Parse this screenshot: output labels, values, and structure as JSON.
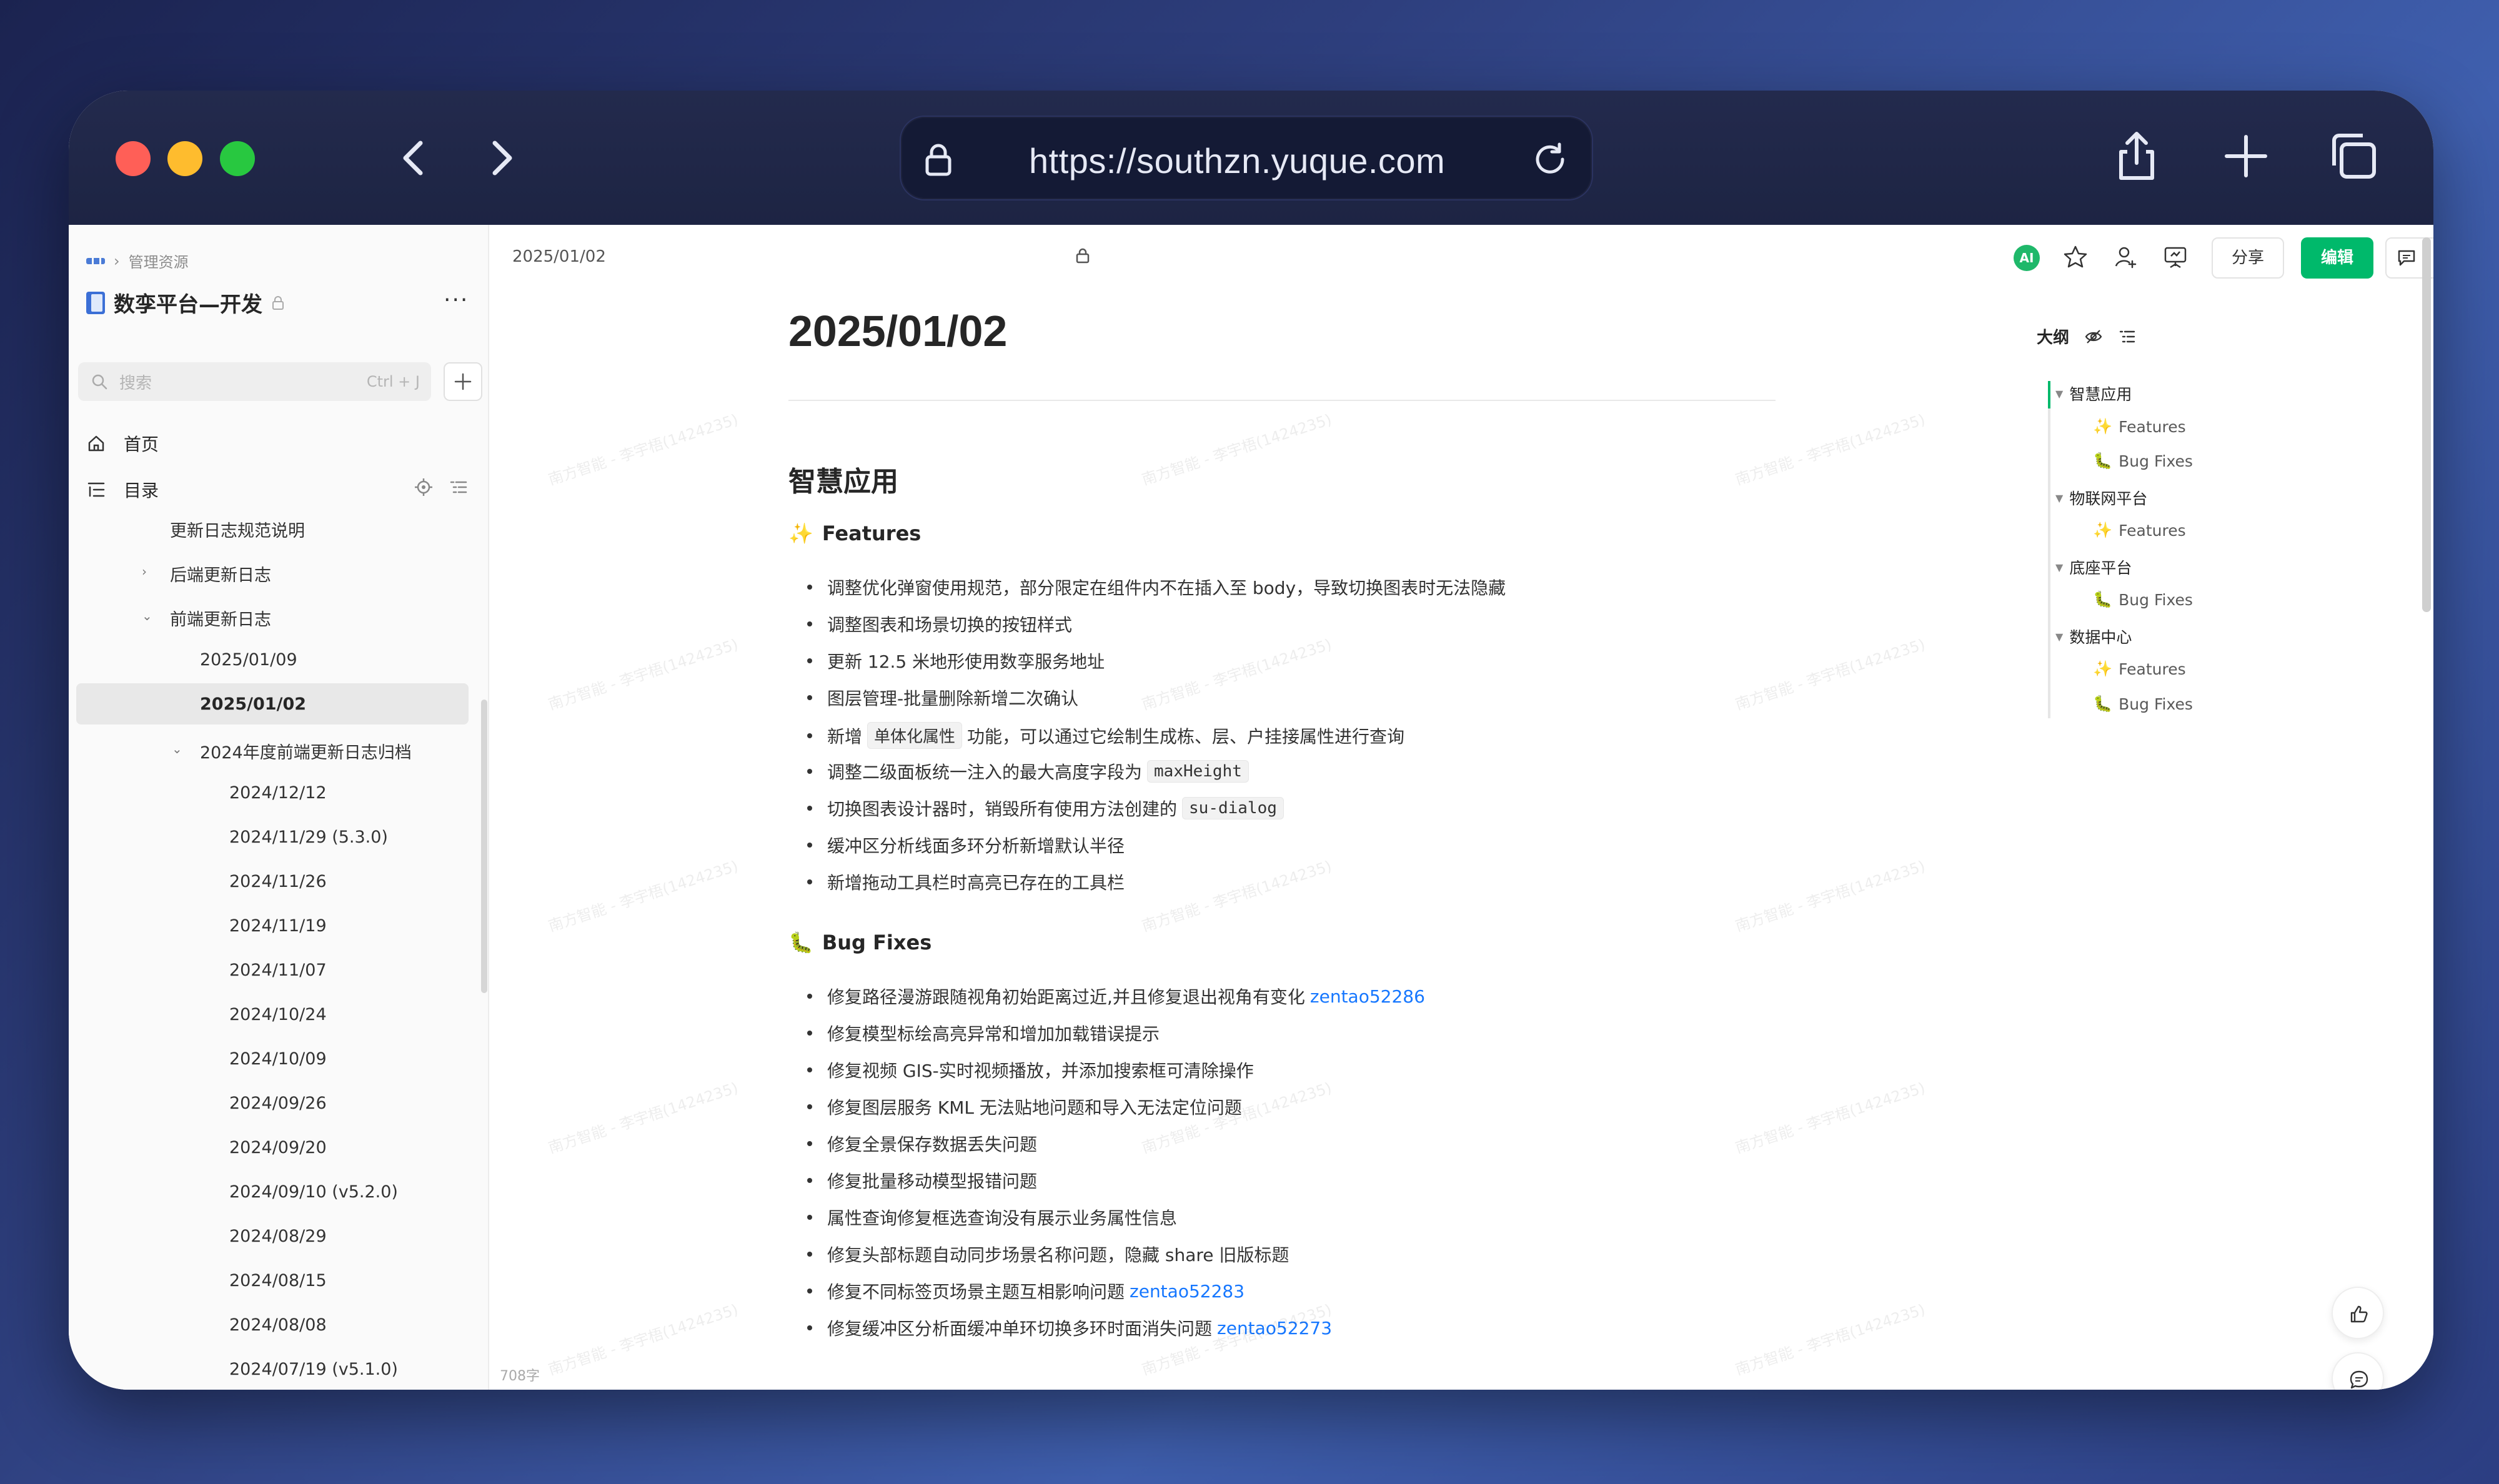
{
  "browser": {
    "url": "https://southzn.yuque.com"
  },
  "sidebar": {
    "breadcrumb": "管理资源",
    "space_title": "数孪平台—开发",
    "search_placeholder": "搜索",
    "search_shortcut": "Ctrl + J",
    "home_label": "首页",
    "toc_label": "目录",
    "tree": [
      {
        "label": "更新日志规范说明",
        "level": 1,
        "expander": ""
      },
      {
        "label": "后端更新日志",
        "level": 1,
        "expander": "collapsed"
      },
      {
        "label": "前端更新日志",
        "level": 1,
        "expander": "expanded"
      },
      {
        "label": "2025/01/09",
        "level": 2,
        "expander": ""
      },
      {
        "label": "2025/01/02",
        "level": 2,
        "expander": "",
        "selected": true
      },
      {
        "label": "2024年度前端更新日志归档",
        "level": 2,
        "expander": "expanded"
      },
      {
        "label": "2024/12/12",
        "level": 3,
        "expander": ""
      },
      {
        "label": "2024/11/29 (5.3.0)",
        "level": 3,
        "expander": ""
      },
      {
        "label": "2024/11/26",
        "level": 3,
        "expander": ""
      },
      {
        "label": "2024/11/19",
        "level": 3,
        "expander": ""
      },
      {
        "label": "2024/11/07",
        "level": 3,
        "expander": ""
      },
      {
        "label": "2024/10/24",
        "level": 3,
        "expander": ""
      },
      {
        "label": "2024/10/09",
        "level": 3,
        "expander": ""
      },
      {
        "label": "2024/09/26",
        "level": 3,
        "expander": ""
      },
      {
        "label": "2024/09/20",
        "level": 3,
        "expander": ""
      },
      {
        "label": "2024/09/10 (v5.2.0)",
        "level": 3,
        "expander": ""
      },
      {
        "label": "2024/08/29",
        "level": 3,
        "expander": ""
      },
      {
        "label": "2024/08/15",
        "level": 3,
        "expander": ""
      },
      {
        "label": "2024/08/08",
        "level": 3,
        "expander": ""
      },
      {
        "label": "2024/07/19 (v5.1.0)",
        "level": 3,
        "expander": ""
      }
    ],
    "word_count": "708字"
  },
  "docbar": {
    "date": "2025/01/02",
    "ai_label": "AI",
    "share_label": "分享",
    "edit_label": "编辑"
  },
  "doc": {
    "title": "2025/01/02",
    "section_title": "智慧应用",
    "features_emoji": "✨",
    "features_title": "Features",
    "features": [
      {
        "parts": [
          {
            "text": "调整优化弹窗使用规范，部分限定在组件内不在插入至 body，导致切换图表时无法隐藏"
          }
        ]
      },
      {
        "parts": [
          {
            "text": "调整图表和场景切换的按钮样式"
          }
        ]
      },
      {
        "parts": [
          {
            "text": "更新 12.5 米地形使用数孪服务地址"
          }
        ]
      },
      {
        "parts": [
          {
            "text": "图层管理-批量删除新增二次确认"
          }
        ]
      },
      {
        "parts": [
          {
            "text": "新增"
          },
          {
            "code": "单体化属性"
          },
          {
            "text": "功能，可以通过它绘制生成栋、层、户挂接属性进行查询"
          }
        ]
      },
      {
        "parts": [
          {
            "text": "调整二级面板统一注入的最大高度字段为"
          },
          {
            "code": "maxHeight"
          }
        ]
      },
      {
        "parts": [
          {
            "text": "切换图表设计器时，销毁所有使用方法创建的"
          },
          {
            "code": "su-dialog"
          }
        ]
      },
      {
        "parts": [
          {
            "text": "缓冲区分析线面多环分析新增默认半径"
          }
        ]
      },
      {
        "parts": [
          {
            "text": "新增拖动工具栏时高亮已存在的工具栏"
          }
        ]
      }
    ],
    "bugfix_emoji": "🐛",
    "bugfix_title": "Bug Fixes",
    "bugfixes": [
      {
        "parts": [
          {
            "text": "修复路径漫游跟随视角初始距离过近,并且修复退出视角有变化"
          },
          {
            "link": "zentao52286"
          }
        ]
      },
      {
        "parts": [
          {
            "text": "修复模型标绘高亮异常和增加加载错误提示"
          }
        ]
      },
      {
        "parts": [
          {
            "text": "修复视频 GIS-实时视频播放，并添加搜索框可清除操作"
          }
        ]
      },
      {
        "parts": [
          {
            "text": "修复图层服务 KML 无法贴地问题和导入无法定位问题"
          }
        ]
      },
      {
        "parts": [
          {
            "text": "修复全景保存数据丢失问题"
          }
        ]
      },
      {
        "parts": [
          {
            "text": "修复批量移动模型报错问题"
          }
        ]
      },
      {
        "parts": [
          {
            "text": "属性查询修复框选查询没有展示业务属性信息"
          }
        ]
      },
      {
        "parts": [
          {
            "text": "修复头部标题自动同步场景名称问题，隐藏 share 旧版标题"
          }
        ]
      },
      {
        "parts": [
          {
            "text": "修复不同标签页场景主题互相影响问题"
          },
          {
            "link": "zentao52283"
          }
        ]
      },
      {
        "parts": [
          {
            "text": "修复缓冲区分析面缓冲单环切换多环时面消失问题"
          },
          {
            "link": "zentao52273"
          }
        ]
      }
    ]
  },
  "outline": {
    "title": "大纲",
    "items": [
      {
        "label": "智慧应用",
        "level": 1,
        "icon": ""
      },
      {
        "label": "Features",
        "level": 2,
        "icon": "✨"
      },
      {
        "label": "Bug Fixes",
        "level": 2,
        "icon": "🐛"
      },
      {
        "label": "物联网平台",
        "level": 1,
        "icon": ""
      },
      {
        "label": "Features",
        "level": 2,
        "icon": "✨"
      },
      {
        "label": "底座平台",
        "level": 1,
        "icon": ""
      },
      {
        "label": "Bug Fixes",
        "level": 2,
        "icon": "🐛"
      },
      {
        "label": "数据中心",
        "level": 1,
        "icon": ""
      },
      {
        "label": "Features",
        "level": 2,
        "icon": "✨"
      },
      {
        "label": "Bug Fixes",
        "level": 2,
        "icon": "🐛"
      }
    ]
  },
  "watermark": "南方智能 - 李宇梧(1424235)",
  "colors": {
    "accent": "#00b96b",
    "link": "#1677ff"
  }
}
